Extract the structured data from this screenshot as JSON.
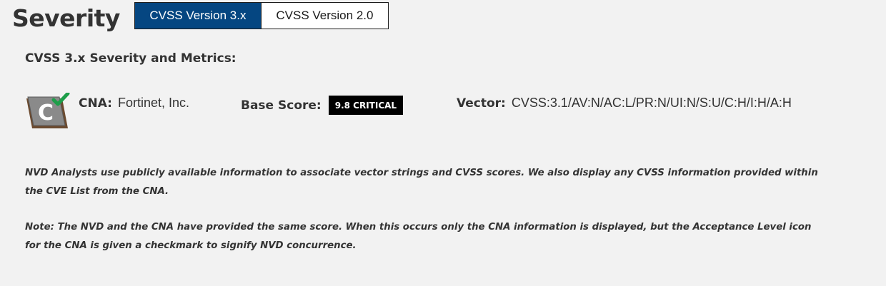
{
  "page": {
    "title": "Severity"
  },
  "tabs": [
    {
      "label": "CVSS Version 3.x",
      "active": true
    },
    {
      "label": "CVSS Version 2.0",
      "active": false
    }
  ],
  "section": {
    "title": "CVSS 3.x Severity and Metrics:"
  },
  "metrics": {
    "icon": "cna-acceptance-level-checkmark-icon",
    "cna_label": "CNA:",
    "cna_value": "Fortinet, Inc.",
    "base_score_label": "Base Score:",
    "base_score_badge": "9.8 CRITICAL",
    "vector_label": "Vector:",
    "vector_value": "CVSS:3.1/AV:N/AC:L/PR:N/UI:N/S:U/C:H/I:H/A:H"
  },
  "notes": {
    "analysts": "NVD Analysts use publicly available information to associate vector strings and CVSS scores. We also display any CVSS information provided within the CVE List from the CNA.",
    "concurrence": "Note: The NVD and the CNA have provided the same score. When this occurs only the CNA information is displayed, but the Acceptance Level icon for the CNA is given a checkmark to signify NVD concurrence."
  },
  "colors": {
    "background": "#f2f2f2",
    "active_tab": "#054681",
    "critical_badge": "#000000",
    "checkmark": "#1e9e4a",
    "icon_brown": "#6b4a2f"
  }
}
